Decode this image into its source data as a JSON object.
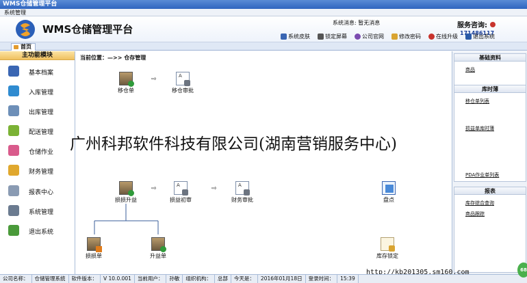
{
  "window": {
    "title": "WMS仓储管理平台"
  },
  "menu": {
    "system": "系统管理"
  },
  "header": {
    "app_title": "WMS仓储管理平台",
    "sysmsg_label": "系统消息:",
    "sysmsg_value": "暂无消息",
    "service_label": "服务咨询:",
    "service_phone": "171486117",
    "toolbar": [
      {
        "label": "系统皮肤",
        "icon": "skin-icon",
        "color": "#3a66b3"
      },
      {
        "label": "锁定屏幕",
        "icon": "lock-icon",
        "color": "#555555"
      },
      {
        "label": "公司官网",
        "icon": "globe-icon",
        "color": "#7b4bb0"
      },
      {
        "label": "修改密码",
        "icon": "key-icon",
        "color": "#d9a431"
      },
      {
        "label": "在线升级",
        "icon": "upgrade-icon",
        "color": "#c8342e"
      },
      {
        "label": "退出系统",
        "icon": "exit-icon",
        "color": "#2a5aa8"
      }
    ]
  },
  "tabs": {
    "home": "首页"
  },
  "sidebar": {
    "title": "主功能模块",
    "items": [
      {
        "label": "基本档案",
        "icon": "archive-icon",
        "color": "#3a66b3"
      },
      {
        "label": "入库管理",
        "icon": "inbound-icon",
        "color": "#2f8bd0"
      },
      {
        "label": "出库管理",
        "icon": "outbound-icon",
        "color": "#6d8fb8"
      },
      {
        "label": "配送管理",
        "icon": "delivery-icon",
        "color": "#7bb235"
      },
      {
        "label": "仓储作业",
        "icon": "warehouse-icon",
        "color": "#d95b8c"
      },
      {
        "label": "财务管理",
        "icon": "finance-icon",
        "color": "#e0a82e"
      },
      {
        "label": "报表中心",
        "icon": "report-icon",
        "color": "#8a9bb3"
      },
      {
        "label": "系统管理",
        "icon": "settings-icon",
        "color": "#6b7b90"
      },
      {
        "label": "退出系统",
        "icon": "exit-icon",
        "color": "#4a9a3a"
      }
    ]
  },
  "main": {
    "breadcrumb": "当前位置：—>>  仓存管理",
    "nodes": {
      "move_order": "移仓单",
      "move_approve": "移仓审批",
      "loss_gain": "损损升益",
      "loss_gain_review": "损益初审",
      "finance_approve": "财务审批",
      "stocktake": "盘点",
      "loss_order": "损损单",
      "gain_order": "升益单",
      "stock_lock": "库存锁定"
    },
    "watermark": "广州科邦软件科技有限公司(湖南营销服务中心)",
    "url": "http://kb201305.sm160.com"
  },
  "rightpanel": {
    "groups": [
      {
        "title": "基础资料",
        "links": [
          "商品"
        ]
      },
      {
        "title": "库时薄",
        "links": [
          "移仓单列表",
          "损益单库时薄",
          "PDA作业单列表"
        ]
      },
      {
        "title": "报表",
        "links": [
          "库存综合查询",
          "商品跟踪"
        ]
      }
    ]
  },
  "status": {
    "company_label": "公司名称：",
    "company_value": "仓储管理系统",
    "version_label": "软件版本：",
    "version_value": "V 10.0.001",
    "user_label": "当前用户：",
    "user_value": "孙敏",
    "org_label": "组织机构：",
    "org_value": "总部",
    "today_label": "今天是：",
    "today_value": "2016年01月18日",
    "login_label": "登录时间：",
    "login_value": "15:39",
    "badge": "68"
  }
}
